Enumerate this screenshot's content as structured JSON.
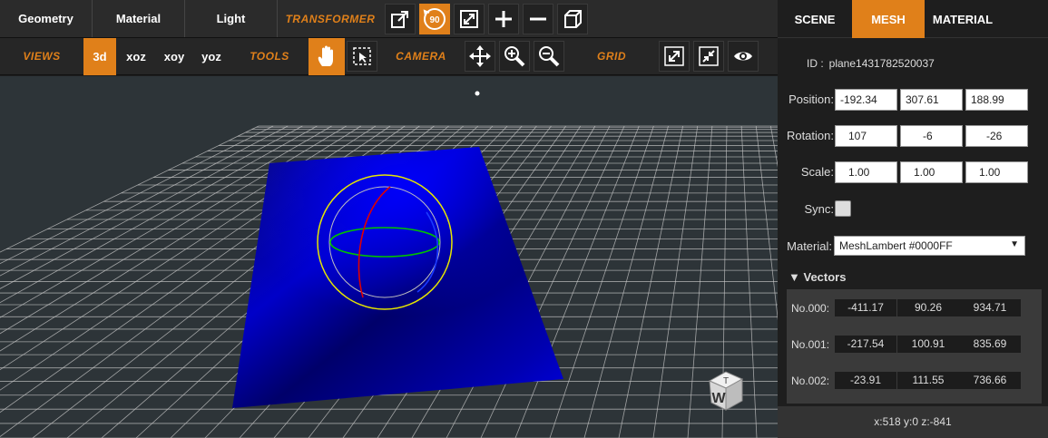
{
  "menu": {
    "items": [
      {
        "label": "Geometry"
      },
      {
        "label": "Material"
      },
      {
        "label": "Light"
      }
    ],
    "transformer_label": "TRANSFORMER",
    "rotate_badge": "90"
  },
  "toolbar": {
    "views_label": "VIEWS",
    "views": [
      "3d",
      "xoz",
      "xoy",
      "yoz"
    ],
    "active_view": "3d",
    "tools_label": "TOOLS",
    "camera_label": "CAMERA",
    "grid_label": "GRID"
  },
  "panel": {
    "tabs": [
      "SCENE",
      "MESH",
      "MATERIAL"
    ],
    "active_tab": "MESH",
    "id_label": "ID :",
    "id_value": "plane1431782520037",
    "position_label": "Position:",
    "position": [
      "-192.34",
      "307.61",
      "188.99"
    ],
    "rotation_label": "Rotation:",
    "rotation": [
      "107",
      "-6",
      "-26"
    ],
    "scale_label": "Scale:",
    "scale": [
      "1.00",
      "1.00",
      "1.00"
    ],
    "sync_label": "Sync:",
    "material_label": "Material:",
    "material_value": "MeshLambert #0000FF",
    "vectors_label": "Vectors",
    "vectors": [
      {
        "label": "No.000:",
        "values": [
          "-411.17",
          "90.26",
          "934.71"
        ]
      },
      {
        "label": "No.001:",
        "values": [
          "-217.54",
          "100.91",
          "835.69"
        ]
      },
      {
        "label": "No.002:",
        "values": [
          "-23.91",
          "111.55",
          "736.66"
        ]
      }
    ],
    "status": "x:518 y:0 z:-841"
  },
  "viewcube": {
    "top_label": "T",
    "front_label": "W"
  },
  "colors": {
    "accent": "#e0801a",
    "plane": "#0000ff",
    "viewport_bg": "#2d3438",
    "grid": "#c8c8c8"
  }
}
